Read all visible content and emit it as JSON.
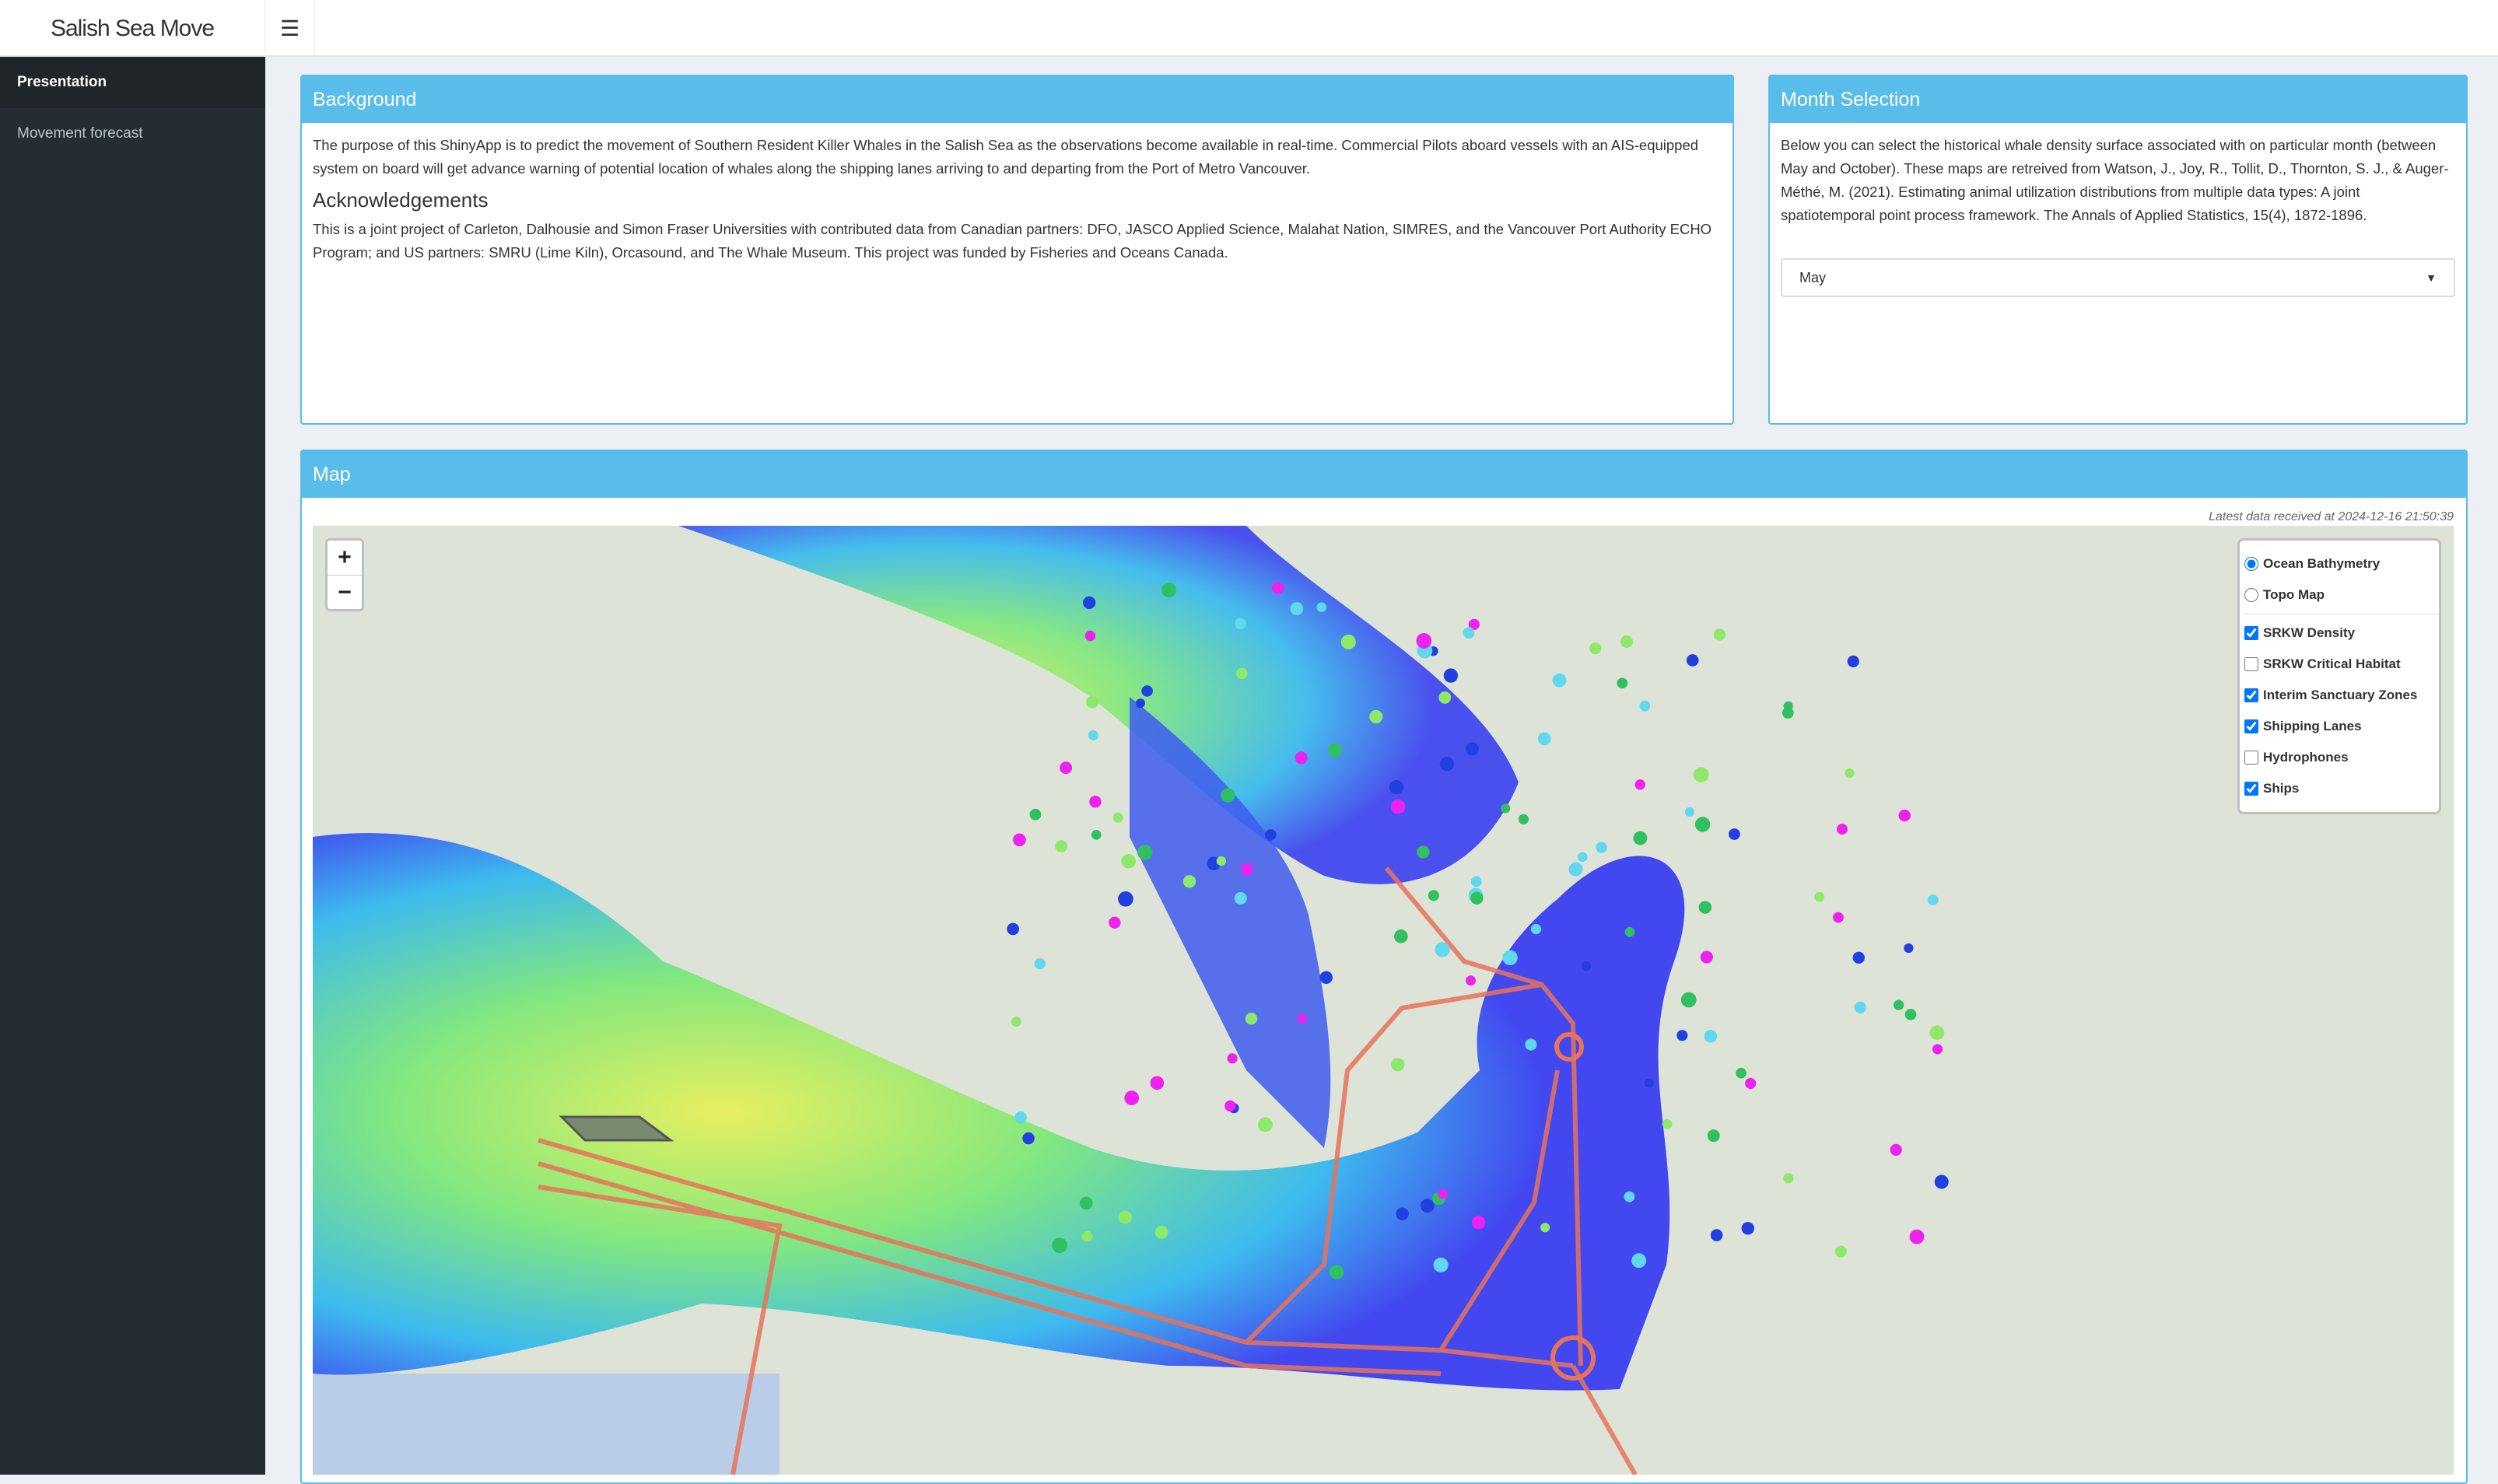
{
  "header": {
    "brand": "Salish Sea Move",
    "menu_icon": "hamburger-icon"
  },
  "sidebar": {
    "items": [
      {
        "label": "Presentation",
        "active": true
      },
      {
        "label": "Movement forecast",
        "active": false
      }
    ]
  },
  "background": {
    "title": "Background",
    "text": "The purpose of this ShinyApp is to predict the movement of Southern Resident Killer Whales in the Salish Sea as the observations become available in real-time. Commercial Pilots aboard vessels with an AIS-equipped system on board will get advance warning of potential location of whales along the shipping lanes arriving to and departing from the Port of Metro Vancouver.",
    "ack_title": "Acknowledgements",
    "ack_text": "This is a joint project of Carleton, Dalhousie and Simon Fraser Universities with contributed data from Canadian partners: DFO, JASCO Applied Science, Malahat Nation, SIMRES, and the Vancouver Port Authority ECHO Program; and US partners: SMRU (Lime Kiln), Orcasound, and The Whale Museum. This project was funded by Fisheries and Oceans Canada."
  },
  "month": {
    "title": "Month Selection",
    "text": "Below you can select the historical whale density surface associated with on particular month (between May and October). These maps are retreived from Watson, J., Joy, R., Tollit, D., Thornton, S. J., & Auger-Méthé, M. (2021). Estimating animal utilization distributions from multiple data types: A joint spatiotemporal point process framework. The Annals of Applied Statistics, 15(4), 1872-1896.",
    "selected": "May"
  },
  "map": {
    "title": "Map",
    "timestamp": "Latest data received at 2024-12-16 21:50:39",
    "zoom_in": "+",
    "zoom_out": "−",
    "base_layers": [
      {
        "label": "Ocean Bathymetry",
        "checked": true
      },
      {
        "label": "Topo Map",
        "checked": false
      }
    ],
    "overlays": [
      {
        "label": "SRKW Density",
        "checked": true
      },
      {
        "label": "SRKW Critical Habitat",
        "checked": false
      },
      {
        "label": "Interim Sanctuary Zones",
        "checked": true
      },
      {
        "label": "Shipping Lanes",
        "checked": true
      },
      {
        "label": "Hydrophones",
        "checked": false
      },
      {
        "label": "Ships",
        "checked": true
      }
    ],
    "colors": {
      "header": "#58bdea",
      "lanes": "#e8735a",
      "density_low": "#3a3ff0",
      "density_high": "#e8f05a"
    }
  }
}
